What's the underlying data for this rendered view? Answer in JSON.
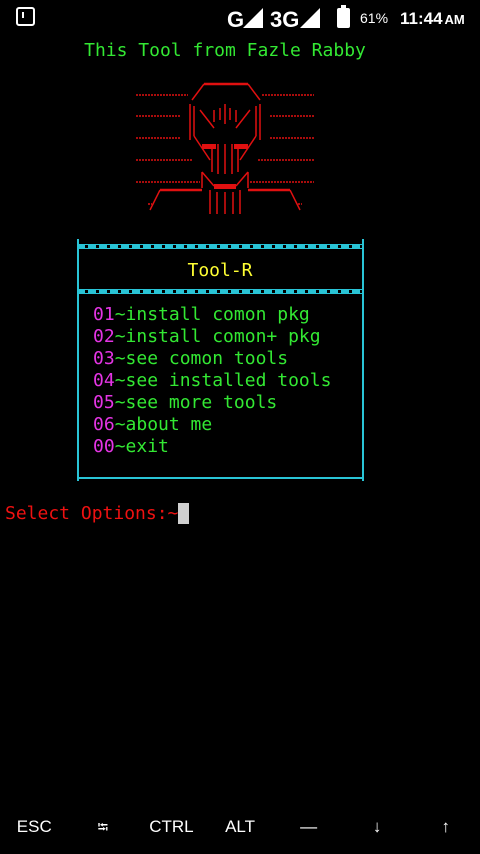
{
  "status_bar": {
    "network_1": "G",
    "network_2": "3G",
    "battery": "61%",
    "time": "11:44",
    "ampm": "AM",
    "icons": [
      "notification-icon",
      "signal-icon",
      "signal-icon",
      "battery-icon"
    ]
  },
  "terminal": {
    "banner": "This Tool from Fazle Rabby",
    "tool_title": "Tool-R",
    "menu": [
      {
        "num": "01",
        "text": "~install comon pkg"
      },
      {
        "num": "02",
        "text": "~install comon+ pkg"
      },
      {
        "num": "03",
        "text": "~see comon tools"
      },
      {
        "num": "04",
        "text": "~see installed tools"
      },
      {
        "num": "05",
        "text": "~see more tools"
      },
      {
        "num": "06",
        "text": "~about me"
      },
      {
        "num": "00",
        "text": "~exit"
      }
    ],
    "prompt": "Select Options:~",
    "colors": {
      "banner": "#33e833",
      "ascii_art": "#e01010",
      "box": "#29c4d6",
      "title": "#ffff33",
      "menu_num": "#e535e5",
      "menu_text": "#33e833",
      "prompt": "#ee1111"
    }
  },
  "extra_keys": {
    "esc": "ESC",
    "tab": "⭾",
    "ctrl": "CTRL",
    "alt": "ALT",
    "dash": "—",
    "down": "↓",
    "up": "↑"
  }
}
